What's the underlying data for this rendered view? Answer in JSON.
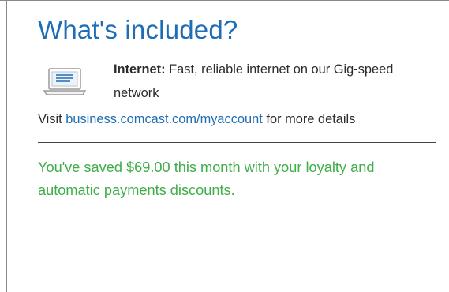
{
  "panel": {
    "title": "What's included?",
    "service": {
      "icon": "laptop-icon",
      "name": "Internet:",
      "description": "Fast, reliable internet on our Gig-speed network"
    },
    "details": {
      "prefix": "Visit",
      "link_text": "business.comcast.com/myaccount",
      "suffix": "for more details"
    },
    "savings_message": "You've saved $69.00 this month with your loyalty and automatic payments discounts."
  },
  "colors": {
    "title": "#1f6db5",
    "link": "#1f6db5",
    "savings": "#3fae49",
    "text": "#2b2b2b"
  }
}
